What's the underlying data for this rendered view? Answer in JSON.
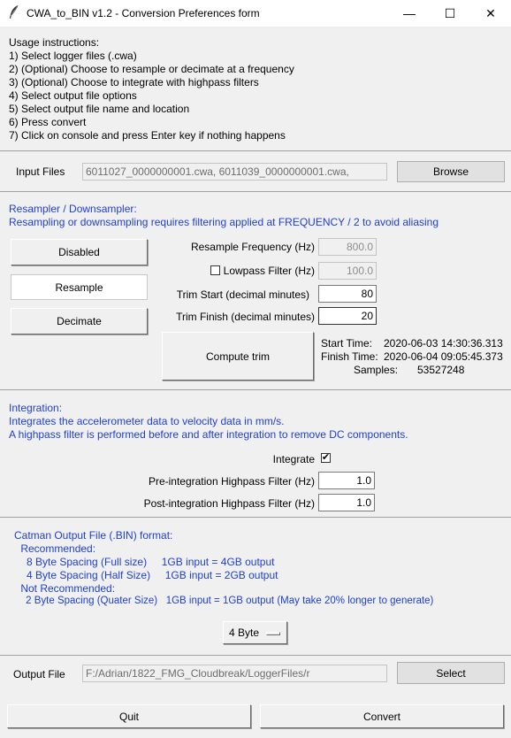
{
  "window": {
    "title": "CWA_to_BIN v1.2 - Conversion Preferences form",
    "minimize_glyph": "—",
    "maximize_glyph": "☐",
    "close_glyph": "✕"
  },
  "usage": {
    "heading": "Usage instructions:",
    "steps": [
      " 1) Select logger files (.cwa)",
      " 2) (Optional) Choose to resample or decimate at a frequency",
      " 3) (Optional) Choose to integrate with highpass filters",
      " 4) Select output file options",
      " 5) Select output file name and location",
      " 6) Press convert",
      " 7) Click on console and press Enter key if nothing happens"
    ]
  },
  "input_files": {
    "label": "Input Files",
    "value": "6011027_0000000001.cwa,  6011039_0000000001.cwa,",
    "browse_label": "Browse"
  },
  "resampler": {
    "heading": "Resampler / Downsampler:",
    "note": "  Resampling or downsampling requires filtering applied at FREQUENCY / 2 to avoid aliasing",
    "disabled_label": "Disabled",
    "resample_label": "Resample",
    "decimate_label": "Decimate",
    "selected_mode": "Resample",
    "freq_label": "Resample Frequency (Hz)",
    "freq_value": "800.0",
    "lowpass_label": "Lowpass Filter (Hz)",
    "lowpass_checked": false,
    "lowpass_value": "100.0",
    "trim_start_label": "Trim Start (decimal minutes)",
    "trim_start_value": "80",
    "trim_finish_label": "Trim Finish (decimal minutes)",
    "trim_finish_value": "20",
    "compute_trim_label": "Compute trim",
    "start_time_label": "Start Time:",
    "start_time_value": "2020-06-03 14:30:36.313",
    "finish_time_label": "Finish Time:",
    "finish_time_value": "2020-06-04 09:05:45.373",
    "samples_label": "Samples:",
    "samples_value": "53527248"
  },
  "integration": {
    "heading": "Integration:",
    "line1": "  Integrates the accelerometer data to velocity data in mm/s.",
    "line2": "  A highpass filter is performed before and after integration to remove DC components.",
    "integrate_label": "Integrate",
    "integrate_checked": true,
    "check_glyph": "✔",
    "pre_label": "Pre-integration Highpass Filter (Hz)",
    "pre_value": "1.0",
    "post_label": "Post-integration Highpass Filter (Hz)",
    "post_value": "1.0"
  },
  "catman": {
    "heading": "Catman Output File (.BIN) format:",
    "lines": [
      "    Recommended:",
      "      8 Byte Spacing (Full size)     1GB input = 4GB output",
      "      4 Byte Spacing (Half Size)     1GB input = 2GB output",
      "    Not Recommended:",
      "      2 Byte Spacing (Quater Size)   1GB input = 1GB output (May take 20% longer to generate)"
    ],
    "byte_option": "4 Byte"
  },
  "output_file": {
    "label": "Output File",
    "value": "F:/Adrian/1822_FMG_Cloudbreak/LoggerFiles/r",
    "select_label": "Select"
  },
  "footer": {
    "quit_label": "Quit",
    "convert_label": "Convert"
  },
  "colors": {
    "blue_text": "#1f3fd0",
    "window_bg": "#f0f0f0"
  }
}
